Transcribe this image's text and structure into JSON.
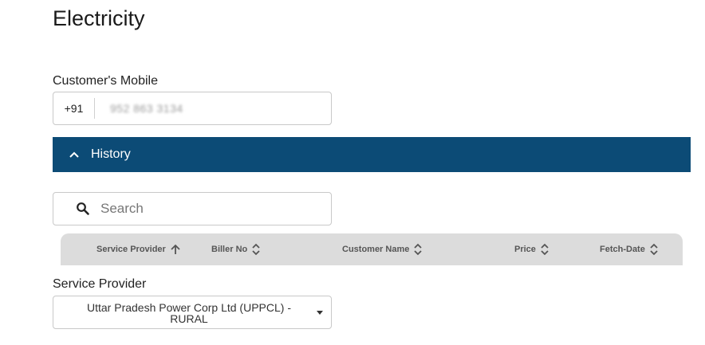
{
  "page": {
    "title": "Electricity"
  },
  "mobile": {
    "label": "Customer's Mobile",
    "country_code": "+91",
    "value": "952 863 3134"
  },
  "history": {
    "label": "History",
    "bar_color": "#0c4b76",
    "expanded": true
  },
  "search": {
    "placeholder": "Search"
  },
  "table": {
    "columns": [
      {
        "label": "Service Provider",
        "sort": "ascending",
        "icon": "arrow-up-icon"
      },
      {
        "label": "Biller No",
        "sort": "none",
        "icon": "sort-icon"
      },
      {
        "label": "Customer Name",
        "sort": "none",
        "icon": "sort-icon"
      },
      {
        "label": "Price",
        "sort": "none",
        "icon": "sort-icon"
      },
      {
        "label": "Fetch-Date",
        "sort": "none",
        "icon": "sort-icon"
      }
    ]
  },
  "provider": {
    "label": "Service Provider",
    "selected": "Uttar Pradesh Power Corp Ltd (UPPCL) - RURAL"
  }
}
